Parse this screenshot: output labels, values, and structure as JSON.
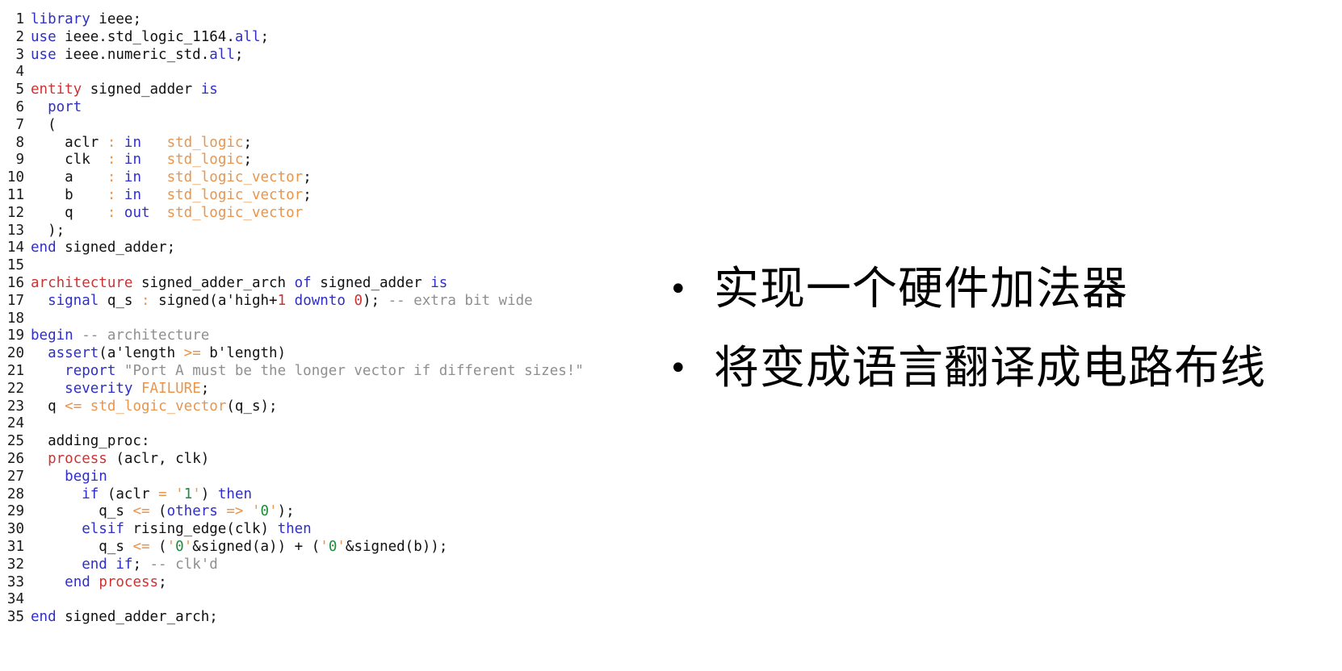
{
  "slide": {
    "background_color": "#ffffff",
    "theme": {
      "keyword_blue": "#2f2fc8",
      "keyword_red": "#cc3333",
      "type_orange": "#e8954e",
      "comment_grey": "#8f8f8f",
      "char_green": "#1e8b3b",
      "plain_black": "#111111"
    }
  },
  "code": {
    "language": "VHDL",
    "first_line_number": 1,
    "last_line_number": 35,
    "lines": [
      {
        "n": "1",
        "tokens": [
          {
            "t": "library",
            "c": "kw"
          },
          {
            "t": " ieee;",
            "c": "pl"
          }
        ]
      },
      {
        "n": "2",
        "tokens": [
          {
            "t": "use",
            "c": "kw"
          },
          {
            "t": " ieee.std_logic_1164.",
            "c": "pl"
          },
          {
            "t": "all",
            "c": "kw"
          },
          {
            "t": ";",
            "c": "pl"
          }
        ]
      },
      {
        "n": "3",
        "tokens": [
          {
            "t": "use",
            "c": "kw"
          },
          {
            "t": " ieee.numeric_std.",
            "c": "pl"
          },
          {
            "t": "all",
            "c": "kw"
          },
          {
            "t": ";",
            "c": "pl"
          }
        ]
      },
      {
        "n": "4",
        "tokens": []
      },
      {
        "n": "5",
        "tokens": [
          {
            "t": "entity",
            "c": "red"
          },
          {
            "t": " signed_adder ",
            "c": "pl"
          },
          {
            "t": "is",
            "c": "kw"
          }
        ]
      },
      {
        "n": "6",
        "tokens": [
          {
            "t": "  ",
            "c": "pl"
          },
          {
            "t": "port",
            "c": "kw"
          }
        ]
      },
      {
        "n": "7",
        "tokens": [
          {
            "t": "  (",
            "c": "pl"
          }
        ]
      },
      {
        "n": "8",
        "tokens": [
          {
            "t": "    aclr ",
            "c": "pl"
          },
          {
            "t": ":",
            "c": "op"
          },
          {
            "t": " ",
            "c": "pl"
          },
          {
            "t": "in",
            "c": "kw"
          },
          {
            "t": "   ",
            "c": "pl"
          },
          {
            "t": "std_logic",
            "c": "type"
          },
          {
            "t": ";",
            "c": "pl"
          }
        ]
      },
      {
        "n": "9",
        "tokens": [
          {
            "t": "    clk  ",
            "c": "pl"
          },
          {
            "t": ":",
            "c": "op"
          },
          {
            "t": " ",
            "c": "pl"
          },
          {
            "t": "in",
            "c": "kw"
          },
          {
            "t": "   ",
            "c": "pl"
          },
          {
            "t": "std_logic",
            "c": "type"
          },
          {
            "t": ";",
            "c": "pl"
          }
        ]
      },
      {
        "n": "10",
        "tokens": [
          {
            "t": "    a    ",
            "c": "pl"
          },
          {
            "t": ":",
            "c": "op"
          },
          {
            "t": " ",
            "c": "pl"
          },
          {
            "t": "in",
            "c": "kw"
          },
          {
            "t": "   ",
            "c": "pl"
          },
          {
            "t": "std_logic_vector",
            "c": "type"
          },
          {
            "t": ";",
            "c": "pl"
          }
        ]
      },
      {
        "n": "11",
        "tokens": [
          {
            "t": "    b    ",
            "c": "pl"
          },
          {
            "t": ":",
            "c": "op"
          },
          {
            "t": " ",
            "c": "pl"
          },
          {
            "t": "in",
            "c": "kw"
          },
          {
            "t": "   ",
            "c": "pl"
          },
          {
            "t": "std_logic_vector",
            "c": "type"
          },
          {
            "t": ";",
            "c": "pl"
          }
        ]
      },
      {
        "n": "12",
        "tokens": [
          {
            "t": "    q    ",
            "c": "pl"
          },
          {
            "t": ":",
            "c": "op"
          },
          {
            "t": " ",
            "c": "pl"
          },
          {
            "t": "out",
            "c": "kw"
          },
          {
            "t": "  ",
            "c": "pl"
          },
          {
            "t": "std_logic_vector",
            "c": "type"
          }
        ]
      },
      {
        "n": "13",
        "tokens": [
          {
            "t": "  );",
            "c": "pl"
          }
        ]
      },
      {
        "n": "14",
        "tokens": [
          {
            "t": "end",
            "c": "kw"
          },
          {
            "t": " signed_adder;",
            "c": "pl"
          }
        ]
      },
      {
        "n": "15",
        "tokens": []
      },
      {
        "n": "16",
        "tokens": [
          {
            "t": "architecture",
            "c": "red"
          },
          {
            "t": " signed_adder_arch ",
            "c": "pl"
          },
          {
            "t": "of",
            "c": "kw"
          },
          {
            "t": " signed_adder ",
            "c": "pl"
          },
          {
            "t": "is",
            "c": "kw"
          }
        ]
      },
      {
        "n": "17",
        "tokens": [
          {
            "t": "  ",
            "c": "pl"
          },
          {
            "t": "signal",
            "c": "kw"
          },
          {
            "t": " q_s ",
            "c": "pl"
          },
          {
            "t": ":",
            "c": "op"
          },
          {
            "t": " signed(a'high+",
            "c": "pl"
          },
          {
            "t": "1",
            "c": "num"
          },
          {
            "t": " ",
            "c": "pl"
          },
          {
            "t": "downto",
            "c": "kw"
          },
          {
            "t": " ",
            "c": "pl"
          },
          {
            "t": "0",
            "c": "num"
          },
          {
            "t": "); ",
            "c": "pl"
          },
          {
            "t": "-- extra bit wide",
            "c": "cmt"
          }
        ]
      },
      {
        "n": "18",
        "tokens": []
      },
      {
        "n": "19",
        "tokens": [
          {
            "t": "begin",
            "c": "kw"
          },
          {
            "t": " ",
            "c": "pl"
          },
          {
            "t": "-- architecture",
            "c": "cmt"
          }
        ]
      },
      {
        "n": "20",
        "tokens": [
          {
            "t": "  ",
            "c": "pl"
          },
          {
            "t": "assert",
            "c": "kw"
          },
          {
            "t": "(a'length ",
            "c": "pl"
          },
          {
            "t": ">=",
            "c": "op"
          },
          {
            "t": " b'length)",
            "c": "pl"
          }
        ]
      },
      {
        "n": "21",
        "tokens": [
          {
            "t": "    ",
            "c": "pl"
          },
          {
            "t": "report",
            "c": "kw"
          },
          {
            "t": " ",
            "c": "pl"
          },
          {
            "t": "\"Port A must be the longer vector if different sizes!\"",
            "c": "str"
          }
        ]
      },
      {
        "n": "22",
        "tokens": [
          {
            "t": "    ",
            "c": "pl"
          },
          {
            "t": "severity",
            "c": "kw"
          },
          {
            "t": " ",
            "c": "pl"
          },
          {
            "t": "FAILURE",
            "c": "type"
          },
          {
            "t": ";",
            "c": "pl"
          }
        ]
      },
      {
        "n": "23",
        "tokens": [
          {
            "t": "  q ",
            "c": "pl"
          },
          {
            "t": "<=",
            "c": "op"
          },
          {
            "t": " ",
            "c": "pl"
          },
          {
            "t": "std_logic_vector",
            "c": "type"
          },
          {
            "t": "(q_s);",
            "c": "pl"
          }
        ]
      },
      {
        "n": "24",
        "tokens": []
      },
      {
        "n": "25",
        "tokens": [
          {
            "t": "  adding_proc:",
            "c": "pl"
          }
        ]
      },
      {
        "n": "26",
        "tokens": [
          {
            "t": "  ",
            "c": "pl"
          },
          {
            "t": "process",
            "c": "red"
          },
          {
            "t": " (aclr, clk)",
            "c": "pl"
          }
        ]
      },
      {
        "n": "27",
        "tokens": [
          {
            "t": "    ",
            "c": "pl"
          },
          {
            "t": "begin",
            "c": "kw"
          }
        ]
      },
      {
        "n": "28",
        "tokens": [
          {
            "t": "      ",
            "c": "pl"
          },
          {
            "t": "if",
            "c": "kw"
          },
          {
            "t": " (aclr ",
            "c": "pl"
          },
          {
            "t": "=",
            "c": "op"
          },
          {
            "t": " ",
            "c": "pl"
          },
          {
            "t": "'",
            "c": "op"
          },
          {
            "t": "1",
            "c": "chr"
          },
          {
            "t": "'",
            "c": "op"
          },
          {
            "t": ") ",
            "c": "pl"
          },
          {
            "t": "then",
            "c": "kw"
          }
        ]
      },
      {
        "n": "29",
        "tokens": [
          {
            "t": "        q_s ",
            "c": "pl"
          },
          {
            "t": "<=",
            "c": "op"
          },
          {
            "t": " (",
            "c": "pl"
          },
          {
            "t": "others",
            "c": "kw"
          },
          {
            "t": " ",
            "c": "pl"
          },
          {
            "t": "=>",
            "c": "op"
          },
          {
            "t": " ",
            "c": "pl"
          },
          {
            "t": "'",
            "c": "op"
          },
          {
            "t": "0",
            "c": "chr"
          },
          {
            "t": "'",
            "c": "op"
          },
          {
            "t": ");",
            "c": "pl"
          }
        ]
      },
      {
        "n": "30",
        "tokens": [
          {
            "t": "      ",
            "c": "pl"
          },
          {
            "t": "elsif",
            "c": "kw"
          },
          {
            "t": " rising_edge(clk) ",
            "c": "pl"
          },
          {
            "t": "then",
            "c": "kw"
          }
        ]
      },
      {
        "n": "31",
        "tokens": [
          {
            "t": "        q_s ",
            "c": "pl"
          },
          {
            "t": "<=",
            "c": "op"
          },
          {
            "t": " (",
            "c": "pl"
          },
          {
            "t": "'",
            "c": "op"
          },
          {
            "t": "0",
            "c": "chr"
          },
          {
            "t": "'",
            "c": "op"
          },
          {
            "t": "&signed(a)) + (",
            "c": "pl"
          },
          {
            "t": "'",
            "c": "op"
          },
          {
            "t": "0",
            "c": "chr"
          },
          {
            "t": "'",
            "c": "op"
          },
          {
            "t": "&signed(b));",
            "c": "pl"
          }
        ]
      },
      {
        "n": "32",
        "tokens": [
          {
            "t": "      ",
            "c": "pl"
          },
          {
            "t": "end if",
            "c": "kw"
          },
          {
            "t": "; ",
            "c": "pl"
          },
          {
            "t": "-- clk'd",
            "c": "cmt"
          }
        ]
      },
      {
        "n": "33",
        "tokens": [
          {
            "t": "    ",
            "c": "pl"
          },
          {
            "t": "end",
            "c": "kw"
          },
          {
            "t": " ",
            "c": "pl"
          },
          {
            "t": "process",
            "c": "red"
          },
          {
            "t": ";",
            "c": "pl"
          }
        ]
      },
      {
        "n": "34",
        "tokens": []
      },
      {
        "n": "35",
        "tokens": [
          {
            "t": "end",
            "c": "kw"
          },
          {
            "t": " signed_adder_arch;",
            "c": "pl"
          }
        ]
      }
    ]
  },
  "bullets": {
    "marker": "•",
    "items": [
      {
        "text": "实现一个硬件加法器"
      },
      {
        "text": "将变成语言翻译成电路布线"
      }
    ]
  }
}
